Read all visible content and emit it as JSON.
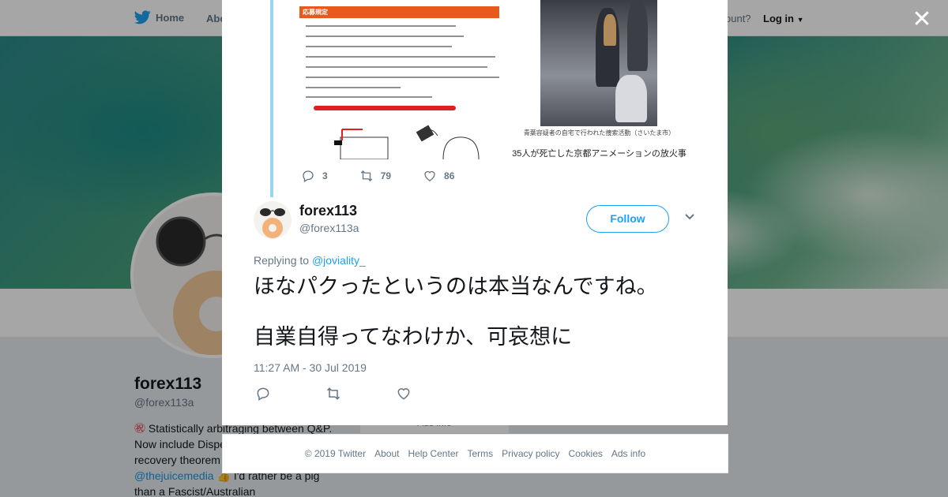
{
  "nav": {
    "home_label": "Home",
    "about_label": "Abo",
    "account_prompt": "ount?",
    "login_label": "Log in"
  },
  "profile": {
    "name": "forex113",
    "handle": "@forex113a",
    "bio_line1": "Statistically arbitraging between Q&P.",
    "bio_line2": "Now include Dispe",
    "bio_line3": "recovery theorem",
    "bio_mention": "@thejuicemedia",
    "bio_line4": "I'd rather be a pig",
    "bio_line5": "than a Fascist/Australian",
    "ads_info": "Ads info"
  },
  "quoted_tweet": {
    "doc_heading": "応募規定",
    "photo_caption": "青葉容疑者の自宅で行われた捜索活動（さいたま市）",
    "news_title": "35人が死亡した京都アニメーションの放火事",
    "reply_count": "3",
    "retweet_count": "79",
    "like_count": "86"
  },
  "tweet": {
    "author_name": "forex113",
    "author_handle": "@forex113a",
    "follow_label": "Follow",
    "replying_prefix": "Replying to",
    "replying_to": "@joviality_",
    "text_line1": "ほなパクったというのは本当なんですね。",
    "text_line2": "自業自得ってなわけか、可哀想に",
    "timestamp": "11:27 AM - 30 Jul 2019"
  },
  "footer": {
    "copyright": "© 2019 Twitter",
    "links": [
      "About",
      "Help Center",
      "Terms",
      "Privacy policy",
      "Cookies",
      "Ads info"
    ]
  },
  "colors": {
    "accent": "#1da1f2",
    "thread_line": "#99d3f0",
    "muted_text": "#657786"
  },
  "icons": {
    "close": "close-icon",
    "reply": "reply-icon",
    "retweet": "retweet-icon",
    "like": "heart-icon",
    "menu": "chevron-down-icon",
    "logo": "twitter-bird-icon"
  }
}
